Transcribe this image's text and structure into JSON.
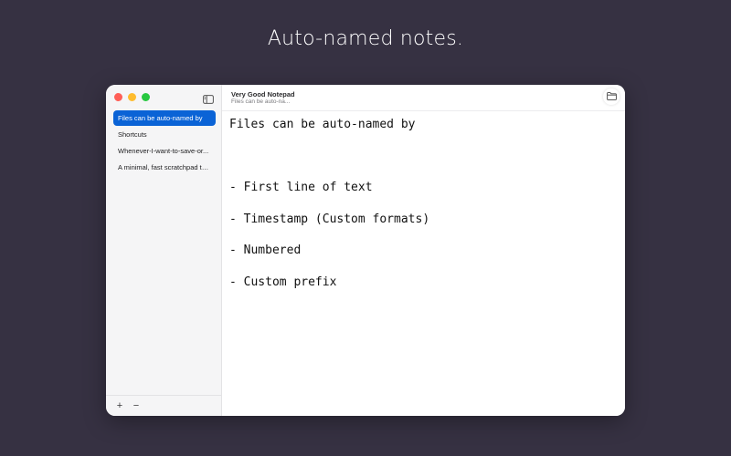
{
  "headline": "Auto-named notes.",
  "window": {
    "title": "Very Good Notepad",
    "subtitle": "Files can be auto-na..."
  },
  "sidebar": {
    "notes": [
      {
        "label": "Files can be auto-named by",
        "selected": true
      },
      {
        "label": "Shortcuts",
        "selected": false
      },
      {
        "label": "Whenever-I-want-to-save-or...",
        "selected": false
      },
      {
        "label": "A minimal, fast scratchpad te...",
        "selected": false
      }
    ],
    "add_label": "+",
    "remove_label": "−"
  },
  "editor": {
    "lines": [
      "Files can be auto-named by",
      "",
      "- First line of text",
      "- Timestamp (Custom formats)",
      "- Numbered",
      "- Custom prefix"
    ]
  },
  "icons": {
    "sidebar_toggle": "sidebar-toggle-icon",
    "folder": "folder-icon"
  },
  "colors": {
    "background": "#363142",
    "selection": "#0a63d6",
    "close": "#ff5f57",
    "minimize": "#febc2e",
    "zoom": "#28c840"
  }
}
